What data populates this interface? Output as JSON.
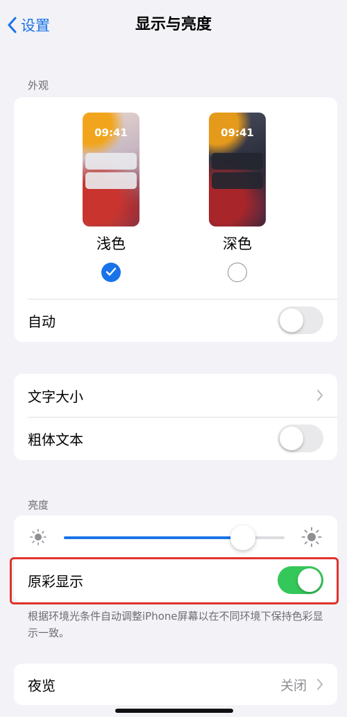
{
  "nav": {
    "back_label": "设置",
    "title": "显示与亮度"
  },
  "appearance": {
    "header": "外观",
    "options": [
      {
        "time": "09:41",
        "label": "浅色",
        "selected": true
      },
      {
        "time": "09:41",
        "label": "深色",
        "selected": false
      }
    ],
    "auto_label": "自动",
    "auto_on": false
  },
  "text": {
    "size_label": "文字大小",
    "bold_label": "粗体文本",
    "bold_on": false
  },
  "brightness": {
    "header": "亮度",
    "level": 0.81,
    "true_tone_label": "原彩显示",
    "true_tone_on": true,
    "footer": "根据环境光条件自动调整iPhone屏幕以在不同环境下保持色彩显示一致。"
  },
  "night_shift": {
    "label": "夜览",
    "value": "关闭"
  },
  "colors": {
    "accent": "#1a73e8",
    "toggle_on": "#34c759",
    "highlight_box": "#e0332b"
  }
}
